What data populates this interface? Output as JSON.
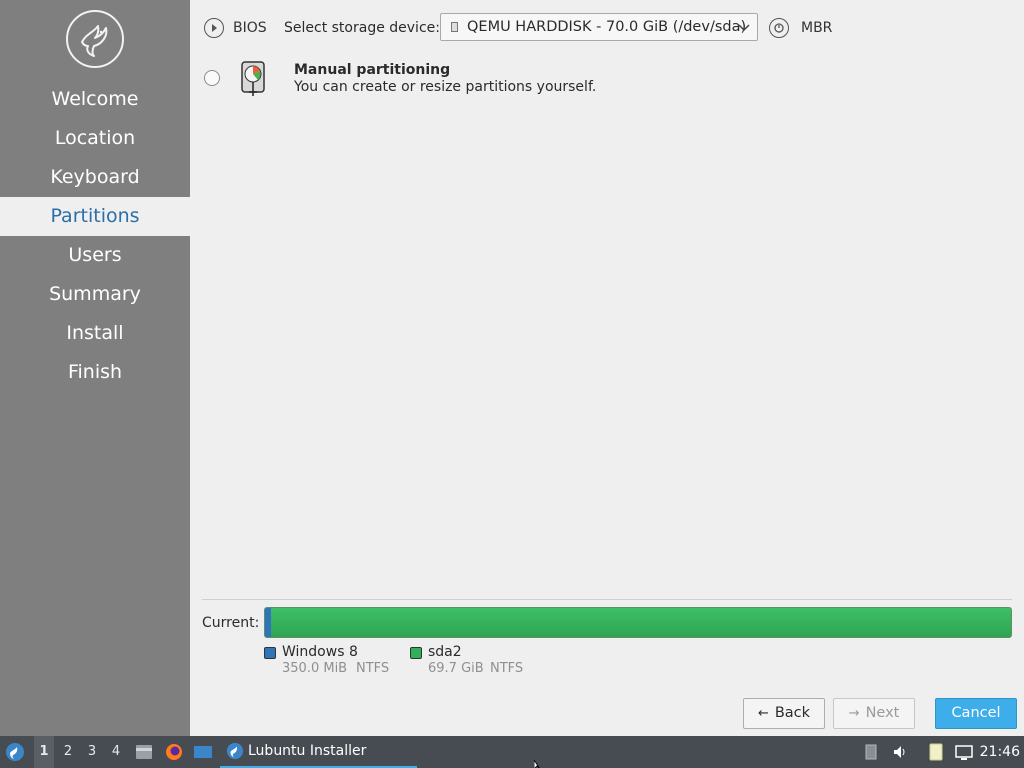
{
  "sidebar": {
    "logo_icon": "lubuntu-bird-logo",
    "steps": [
      "Welcome",
      "Location",
      "Keyboard",
      "Partitions",
      "Users",
      "Summary",
      "Install",
      "Finish"
    ],
    "active_step": "Partitions"
  },
  "topbar": {
    "bios_label": "BIOS",
    "select_label": "Select storage device:",
    "device_value": "QEMU HARDDISK - 70.0 GiB (/dev/sda)",
    "mbr_label": "MBR"
  },
  "option": {
    "title": "Manual partitioning",
    "description": "You can create or resize partitions yourself."
  },
  "current": {
    "label": "Current:",
    "partitions": [
      {
        "name": "Windows 8",
        "size": "350.0 MiB",
        "fs": "NTFS",
        "color": "#2f76b8",
        "fraction": 0.008
      },
      {
        "name": "sda2",
        "size": "69.7 GiB",
        "fs": "NTFS",
        "color": "#31b05a",
        "fraction": 0.992
      }
    ]
  },
  "buttons": {
    "back": "Back",
    "next": "Next",
    "cancel": "Cancel"
  },
  "taskbar": {
    "workspaces": [
      "1",
      "2",
      "3",
      "4"
    ],
    "active_workspace": "1",
    "task_label": "Lubuntu Installer",
    "clock": "21:46"
  },
  "colors": {
    "sidebar": "#7f7f7f",
    "accent": "#3daee9",
    "active_text": "#2a6fa8",
    "taskbar": "#474c52"
  }
}
